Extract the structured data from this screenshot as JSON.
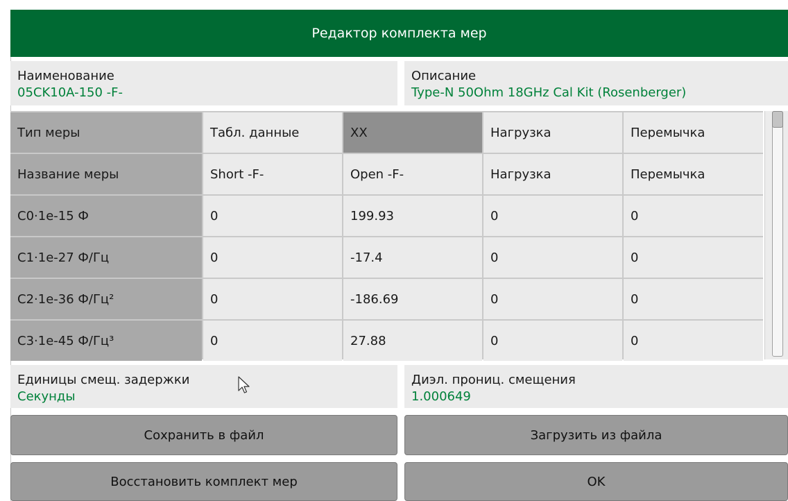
{
  "window": {
    "title": "Редактор комплекта мер"
  },
  "fields": {
    "name": {
      "label": "Наименование",
      "value": "05CK10A-150 -F-"
    },
    "description": {
      "label": "Описание",
      "value": "Type-N 50Ohm 18GHz Cal Kit (Rosenberger)"
    },
    "delay_units": {
      "label": "Единицы смещ. задержки",
      "value": "Секунды"
    },
    "permittivity": {
      "label": "Диэл. прониц. смещения",
      "value": "1.000649"
    }
  },
  "table": {
    "rows": [
      {
        "header": "Тип меры",
        "cells": [
          "Табл. данные",
          "XX",
          "Нагрузка",
          "Перемычка"
        ]
      },
      {
        "header": "Название меры",
        "cells": [
          "Short -F-",
          "Open -F-",
          "Нагрузка",
          "Перемычка"
        ]
      },
      {
        "header": "C0·1e-15 Ф",
        "cells": [
          "0",
          "199.93",
          "0",
          "0"
        ]
      },
      {
        "header": "C1·1e-27 Ф/Гц",
        "cells": [
          "0",
          "-17.4",
          "0",
          "0"
        ]
      },
      {
        "header": "C2·1e-36 Ф/Гц²",
        "cells": [
          "0",
          "-186.69",
          "0",
          "0"
        ]
      },
      {
        "header": "C3·1e-45 Ф/Гц³",
        "cells": [
          "0",
          "27.88",
          "0",
          "0"
        ]
      }
    ],
    "selected_cell": "XX"
  },
  "buttons": {
    "save": "Сохранить в файл",
    "load": "Загрузить из файла",
    "restore": "Восстановить комплект мер",
    "ok": "OK"
  },
  "colors": {
    "title_bar": "#006a33",
    "value_text": "#00813a",
    "header_cell": "#a9a9a9",
    "selected_cell": "#8f8f8f",
    "button": "#9b9b9b"
  },
  "icons": {
    "cursor": "mouse-pointer-icon"
  }
}
